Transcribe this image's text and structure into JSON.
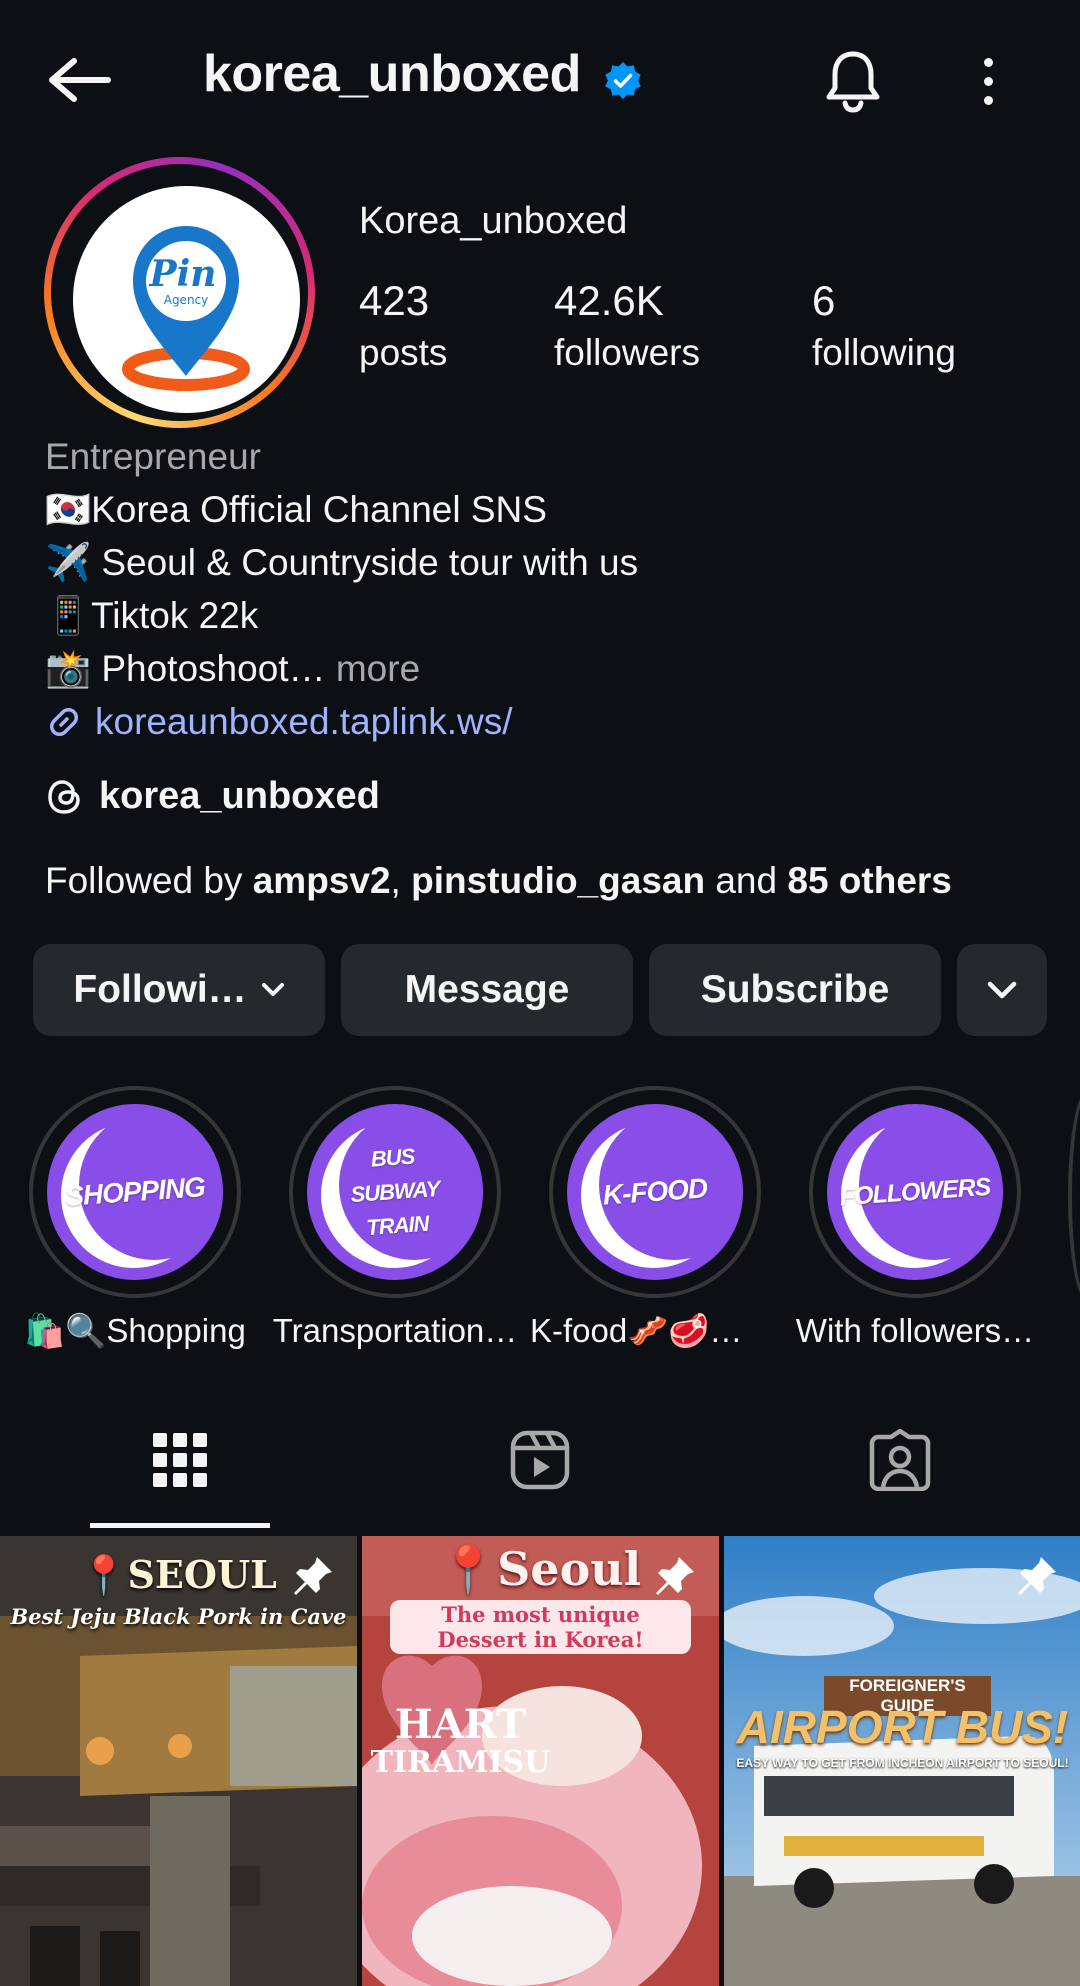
{
  "header": {
    "handle": "korea_unboxed",
    "icons": [
      "back-arrow-icon",
      "verified-badge-icon",
      "bell-icon",
      "more-vertical-icon"
    ]
  },
  "profile": {
    "display_name": "Korea_unboxed",
    "stats": [
      {
        "value": "423",
        "label": "posts"
      },
      {
        "value": "42.6K",
        "label": "followers"
      },
      {
        "value": "6",
        "label": "following"
      }
    ],
    "avatar_text": {
      "main": "Pin",
      "sub": "Agency"
    }
  },
  "bio": {
    "category": "Entrepreneur",
    "lines": [
      "🇰🇷Korea Official Channel SNS",
      "✈️ Seoul & Countryside tour with us",
      "📱Tiktok 22k",
      "📸 Photoshoot…"
    ],
    "more": " more",
    "link": "koreaunboxed.taplink.ws/",
    "threads_handle": "korea_unboxed",
    "followed_by": {
      "prefix": "Followed by ",
      "user1": "ampsv2",
      "sep": ", ",
      "user2": "pinstudio_gasan",
      "mid": " and ",
      "others": "85 others"
    }
  },
  "actions": {
    "following": "Followi…",
    "message": "Message",
    "subscribe": "Subscribe"
  },
  "highlights": [
    {
      "cover": "SHOPPING",
      "label": "🛍️🔍Shopping"
    },
    {
      "cover_lines": [
        "BUS",
        "SUBWAY",
        "TRAIN"
      ],
      "label": "Transportation…"
    },
    {
      "cover": "K-FOOD",
      "label": "K-food🥓🥩🍚…"
    },
    {
      "cover": "FOLLOWERS",
      "label": "With followers…"
    }
  ],
  "tabs": [
    "grid-tab",
    "reels-tab",
    "tagged-tab"
  ],
  "posts": [
    {
      "title": "📍SEOUL",
      "subtitle": "Best Jeju Black Pork in Cave",
      "pinned": true
    },
    {
      "title": "📍Seoul",
      "subtitle": "The most unique Dessert in Korea!",
      "sign1": "HART",
      "sign2": "TIRAMISU",
      "pinned": true
    },
    {
      "kicker": "FOREIGNER'S GUIDE",
      "title": "AIRPORT BUS!",
      "subtitle": "EASY WAY TO GET FROM INCHEON AIRPORT TO SEOUL!",
      "pinned": true
    }
  ],
  "colors": {
    "background": "#0c1014",
    "button": "#25292e",
    "link": "#a1b3ff",
    "verified": "#0095f6",
    "highlight": "#8a4ee8"
  }
}
